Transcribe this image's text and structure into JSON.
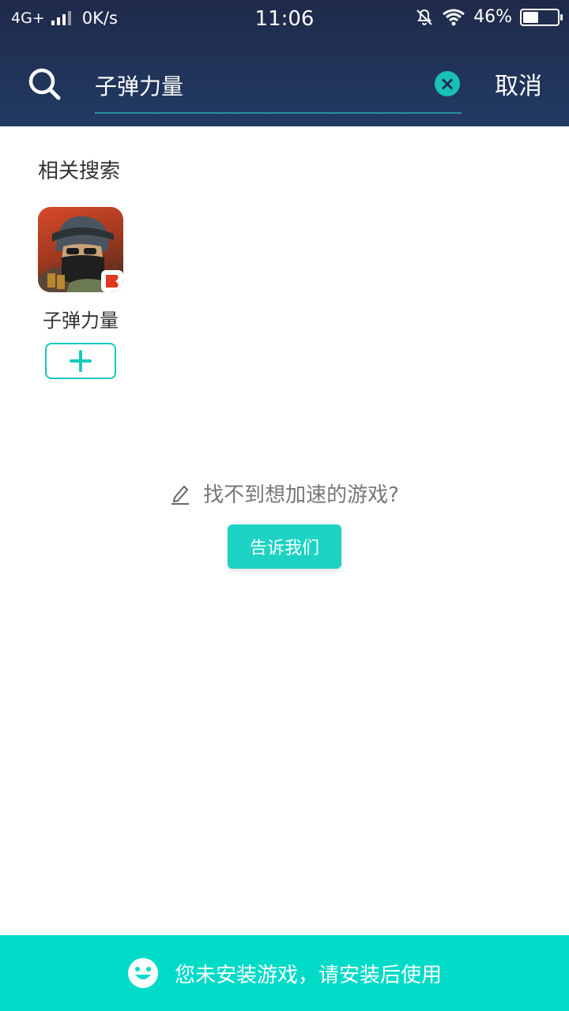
{
  "status_bar": {
    "network": "4G+",
    "speed": "0K/s",
    "time": "11:06",
    "battery": "46%",
    "battery_level": 0.46
  },
  "search": {
    "query": "子弹力量",
    "cancel_label": "取消"
  },
  "related": {
    "title": "相关搜索",
    "items": [
      {
        "name": "子弹力量",
        "icon": "game-soldier-icon"
      }
    ]
  },
  "feedback": {
    "prompt": "找不到想加速的游戏?",
    "button_label": "告诉我们"
  },
  "bottom_bar": {
    "message": "您未安装游戏，请安装后使用"
  },
  "colors": {
    "header_top": "#1f2a4a",
    "header_bottom": "#223a63",
    "accent": "#1dd3c3",
    "bottom_bar": "#00dbc7"
  }
}
